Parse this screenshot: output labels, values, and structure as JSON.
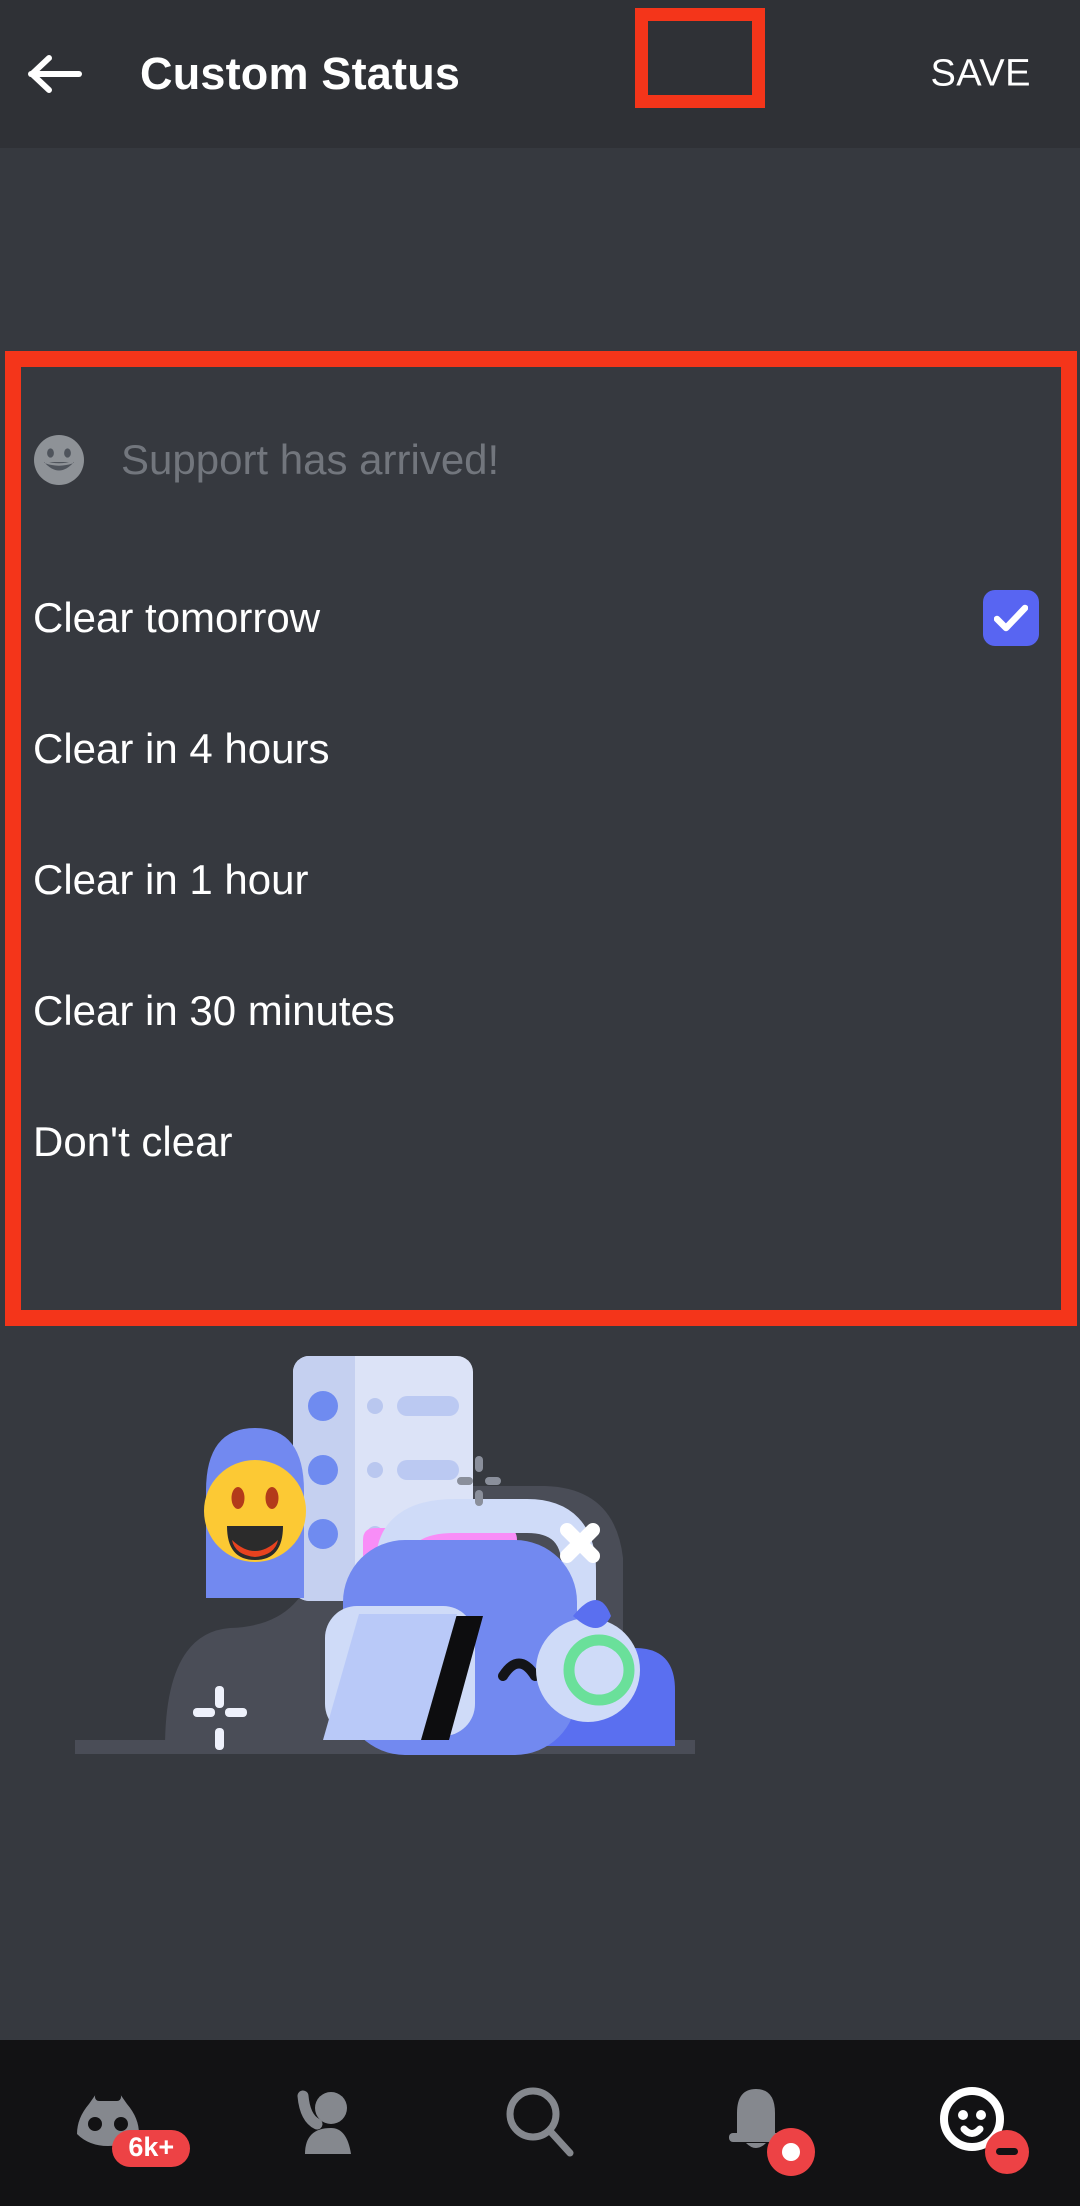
{
  "header": {
    "back_icon": "back-arrow-icon",
    "title": "Custom Status",
    "save_label": "SAVE"
  },
  "status": {
    "emoji_icon": "smiley-face-icon",
    "value": "",
    "placeholder": "Support has arrived!"
  },
  "clear_options": [
    {
      "label": "Clear tomorrow",
      "selected": true
    },
    {
      "label": "Clear in 4 hours",
      "selected": false
    },
    {
      "label": "Clear in 1 hour",
      "selected": false
    },
    {
      "label": "Clear in 30 minutes",
      "selected": false
    },
    {
      "label": "Don't clear",
      "selected": false
    }
  ],
  "illustration": {
    "name": "wumpus-laptop-status-illustration",
    "elements": [
      "blob-background",
      "emoji-pin-with-smiley",
      "list-card",
      "pink-speech-bubble",
      "wumpus-with-headphones",
      "laptop",
      "sparkle",
      "star-burst",
      "x-mark"
    ]
  },
  "bottom_nav": [
    {
      "icon": "discord-servers-icon",
      "badge": "6k+",
      "badge_type": "count",
      "active": false
    },
    {
      "icon": "friends-person-icon",
      "badge": "",
      "badge_type": "none",
      "active": false
    },
    {
      "icon": "search-icon",
      "badge": "",
      "badge_type": "none",
      "active": false
    },
    {
      "icon": "notifications-bell-icon",
      "badge": "",
      "badge_type": "dot",
      "active": false
    },
    {
      "icon": "user-avatar-icon",
      "badge": "",
      "badge_type": "dnd",
      "active": true
    }
  ],
  "colors": {
    "background": "#36393f",
    "header_background": "#2f3136",
    "nav_background": "#121214",
    "annotation_red": "#f4351a",
    "accent_blurple": "#5865f2",
    "badge_red": "#ed4245",
    "text_primary": "#ffffff",
    "text_muted": "#72767d"
  }
}
